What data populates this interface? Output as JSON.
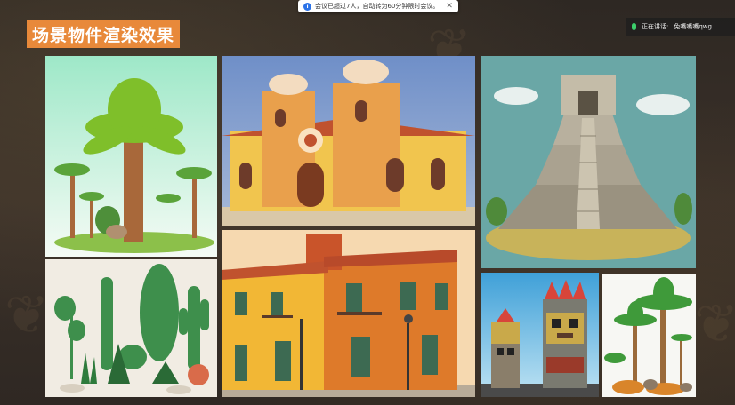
{
  "page": {
    "title": "场景物件渲染效果"
  },
  "toast": {
    "icon": "info-icon",
    "text": "会议已超过7人，自动转为60分钟限时会议。",
    "close_label": "✕"
  },
  "speaker": {
    "label": "正在讲话:",
    "name": "免嘴嘴嘴qwg"
  },
  "gallery": {
    "tiles": [
      {
        "name": "tile-palm-tree",
        "subject": "Cartoon palm tree with small palms"
      },
      {
        "name": "tile-spanish-church",
        "subject": "Yellow Spanish mission church"
      },
      {
        "name": "tile-mayan-pyramid",
        "subject": "Stone step pyramid"
      },
      {
        "name": "tile-cactus-plants",
        "subject": "Assorted cacti and agave"
      },
      {
        "name": "tile-colonial-building",
        "subject": "Colorful colonial street building"
      },
      {
        "name": "tile-totem-statues",
        "subject": "Tribal totem statues"
      },
      {
        "name": "tile-palm-cluster",
        "subject": "Palm trees with rocks"
      }
    ]
  },
  "colors": {
    "accent": "#e8893a",
    "background": "#3a3128",
    "speaking": "#3ccf6b",
    "info": "#2b73e8"
  }
}
